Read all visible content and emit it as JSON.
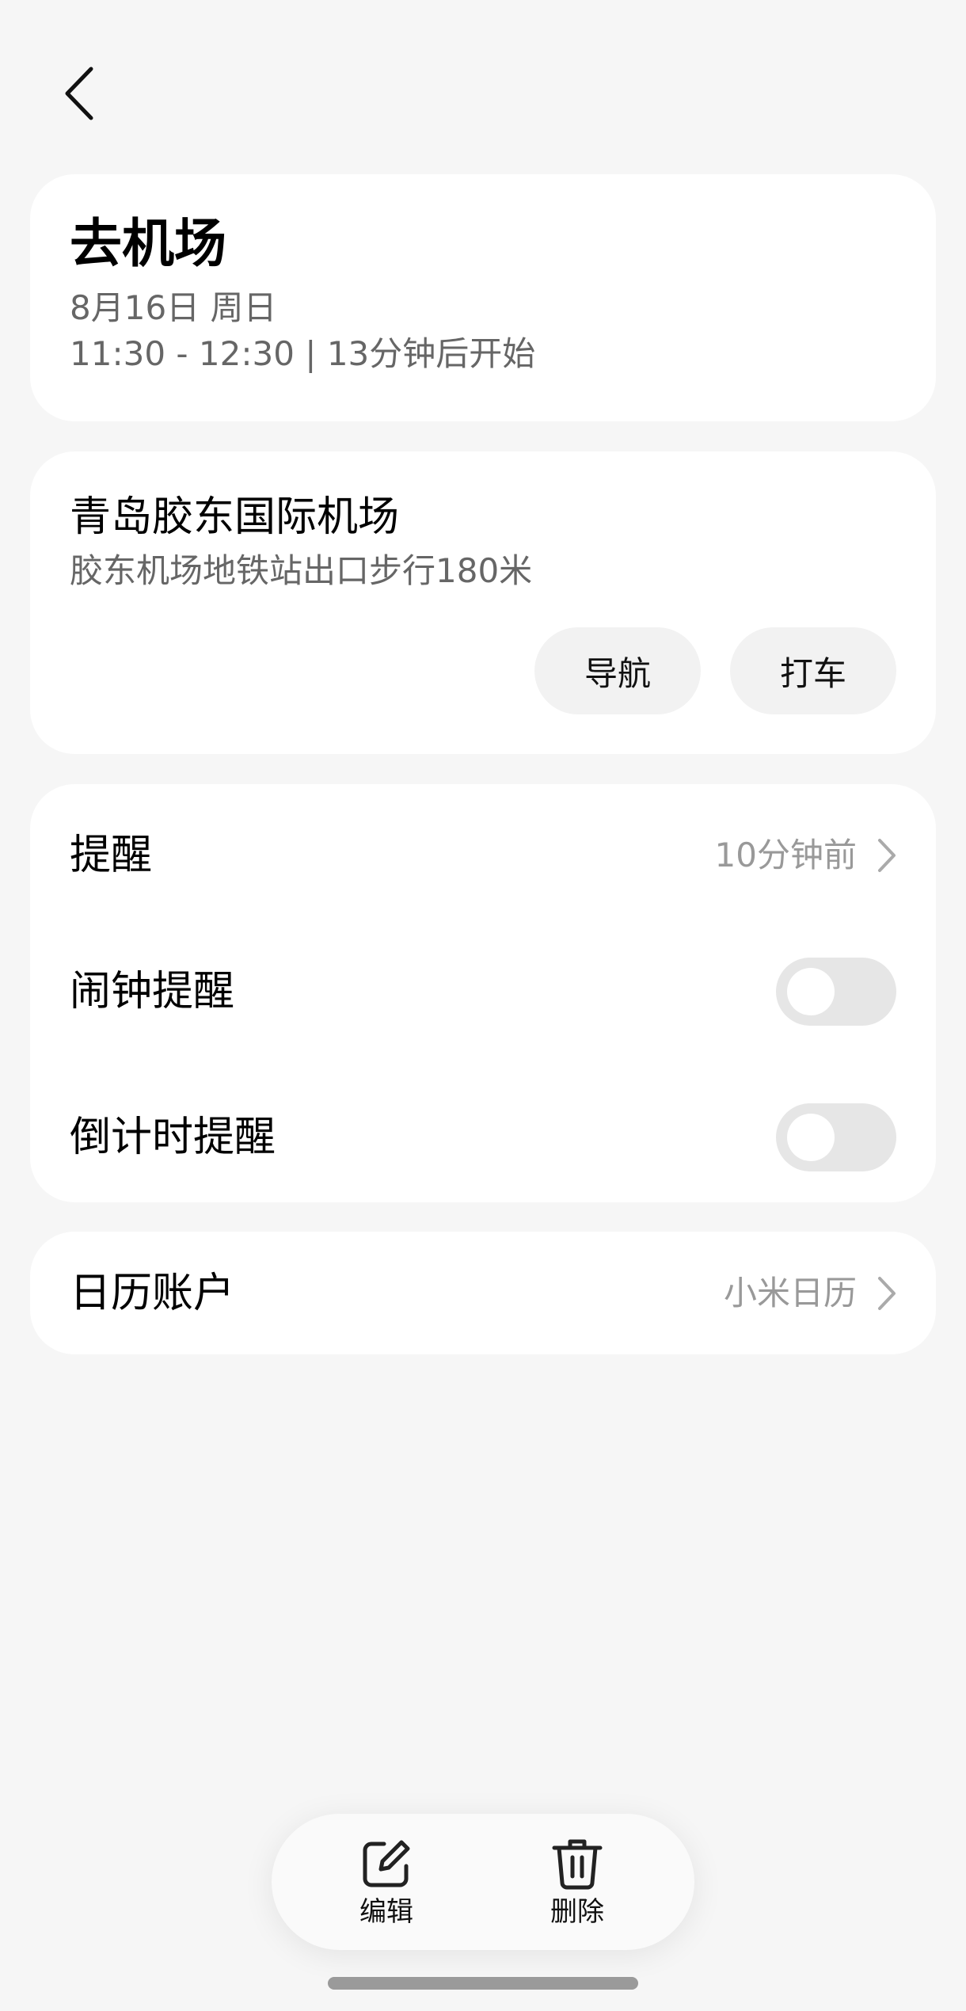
{
  "header": {
    "back_icon": "chevron-left-icon"
  },
  "event": {
    "title": "去机场",
    "date": "8月16日 周日",
    "time_range": "11:30 - 12:30",
    "separator": "|",
    "starts_in": "13分钟后开始"
  },
  "location": {
    "name": "青岛胶东国际机场",
    "detail": "胶东机场地铁站出口步行180米",
    "navigate_label": "导航",
    "taxi_label": "打车"
  },
  "reminders": {
    "reminder_label": "提醒",
    "reminder_value": "10分钟前",
    "alarm_label": "闹钟提醒",
    "alarm_enabled": false,
    "countdown_label": "倒计时提醒",
    "countdown_enabled": false
  },
  "account": {
    "label": "日历账户",
    "value": "小米日历"
  },
  "bottom_bar": {
    "edit_label": "编辑",
    "edit_icon": "edit-icon",
    "delete_label": "删除",
    "delete_icon": "trash-icon"
  },
  "colors": {
    "background": "#f6f6f6",
    "card": "#ffffff",
    "secondary_text": "#666666",
    "value_text": "#999999",
    "toggle_off": "#e6e6e6"
  }
}
